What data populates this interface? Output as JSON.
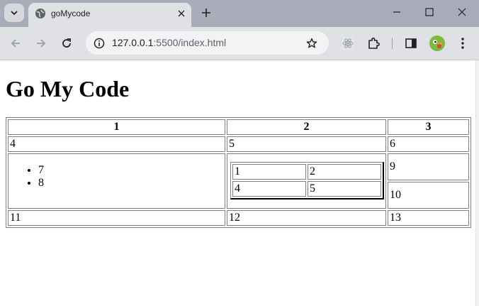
{
  "browser": {
    "tab_title": "goMycode",
    "url_host": "127.0.0.1",
    "url_rest": ":5500/index.html"
  },
  "page": {
    "heading": "Go My Code",
    "table": {
      "header": [
        "1",
        "2",
        "3"
      ],
      "row2": [
        "4",
        "5",
        "6"
      ],
      "list_items": [
        "7",
        "8"
      ],
      "nested": [
        [
          "1",
          "2"
        ],
        [
          "4",
          "5"
        ]
      ],
      "right_cells": [
        "9",
        "10"
      ],
      "row4": [
        "11",
        "12",
        "13"
      ]
    }
  },
  "colors": {
    "tabstrip": "#a9adb9",
    "toolbar": "#dfe1e5",
    "omnibox": "#f1f3f4"
  }
}
